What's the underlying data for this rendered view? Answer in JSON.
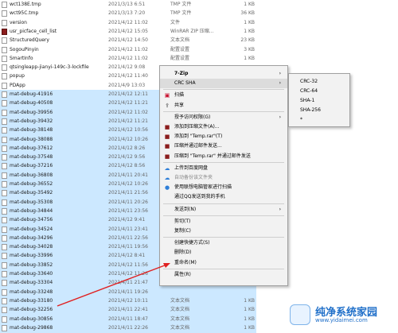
{
  "files": [
    {
      "name": "wct138E.tmp",
      "date": "2021/3/13 6:51",
      "type": "TMP 文件",
      "size": "1 KB",
      "icon": "file",
      "selected": false
    },
    {
      "name": "wct95C.tmp",
      "date": "2021/3/13 7:20",
      "type": "TMP 文件",
      "size": "36 KB",
      "icon": "file",
      "selected": false
    },
    {
      "name": "version",
      "date": "2021/4/12 11:02",
      "type": "文件",
      "size": "1 KB",
      "icon": "file",
      "selected": false
    },
    {
      "name": "usr_picface_cell_list",
      "date": "2021/4/12 15:05",
      "type": "WinRAR ZIP 压缩...",
      "size": "1 KB",
      "icon": "rar",
      "selected": false
    },
    {
      "name": "StructuredQuery",
      "date": "2021/4/12 14:50",
      "type": "文本文档",
      "size": "23 KB",
      "icon": "file",
      "selected": false
    },
    {
      "name": "SogouPinyin",
      "date": "2021/4/12 11:02",
      "type": "配置设置",
      "size": "3 KB",
      "icon": "file",
      "selected": false
    },
    {
      "name": "SmartInfo",
      "date": "2021/4/12 11:02",
      "type": "配置设置",
      "size": "1 KB",
      "icon": "file",
      "selected": false
    },
    {
      "name": "qtsingleapp-jianyi-149c-3-lockfile",
      "date": "2021/4/12 9:08",
      "type": "",
      "size": "",
      "icon": "file",
      "selected": false
    },
    {
      "name": "popup",
      "date": "2021/4/12 11:40",
      "type": "",
      "size": "",
      "icon": "file",
      "selected": false
    },
    {
      "name": "PDApp",
      "date": "2021/4/9 13:03",
      "type": "",
      "size": "",
      "icon": "file",
      "selected": false
    },
    {
      "name": "mat-debug-41916",
      "date": "2021/4/12 12:11",
      "type": "",
      "size": "",
      "icon": "file",
      "selected": true
    },
    {
      "name": "mat-debug-40508",
      "date": "2021/4/12 11:21",
      "type": "",
      "size": "",
      "icon": "file",
      "selected": true
    },
    {
      "name": "mat-debug-39956",
      "date": "2021/4/12 11:02",
      "type": "",
      "size": "",
      "icon": "file",
      "selected": true
    },
    {
      "name": "mat-debug-39432",
      "date": "2021/4/12 11:21",
      "type": "",
      "size": "",
      "icon": "file",
      "selected": true
    },
    {
      "name": "mat-debug-38148",
      "date": "2021/4/12 10:56",
      "type": "",
      "size": "",
      "icon": "file",
      "selected": true
    },
    {
      "name": "mat-debug-38088",
      "date": "2021/4/12 10:26",
      "type": "",
      "size": "",
      "icon": "file",
      "selected": true
    },
    {
      "name": "mat-debug-37612",
      "date": "2021/4/12 8:26",
      "type": "",
      "size": "",
      "icon": "file",
      "selected": true
    },
    {
      "name": "mat-debug-37548",
      "date": "2021/4/12 9:56",
      "type": "",
      "size": "",
      "icon": "file",
      "selected": true
    },
    {
      "name": "mat-debug-37216",
      "date": "2021/4/12 8:56",
      "type": "",
      "size": "",
      "icon": "file",
      "selected": true
    },
    {
      "name": "mat-debug-36808",
      "date": "2021/4/11 20:41",
      "type": "",
      "size": "",
      "icon": "file",
      "selected": true
    },
    {
      "name": "mat-debug-36552",
      "date": "2021/4/12 10:26",
      "type": "",
      "size": "",
      "icon": "file",
      "selected": true
    },
    {
      "name": "mat-debug-35492",
      "date": "2021/4/11 21:56",
      "type": "",
      "size": "",
      "icon": "file",
      "selected": true
    },
    {
      "name": "mat-debug-35308",
      "date": "2021/4/11 20:26",
      "type": "",
      "size": "",
      "icon": "file",
      "selected": true
    },
    {
      "name": "mat-debug-34844",
      "date": "2021/4/11 23:56",
      "type": "",
      "size": "",
      "icon": "file",
      "selected": true
    },
    {
      "name": "mat-debug-34756",
      "date": "2021/4/12 9:41",
      "type": "",
      "size": "",
      "icon": "file",
      "selected": true
    },
    {
      "name": "mat-debug-34524",
      "date": "2021/4/11 23:41",
      "type": "",
      "size": "",
      "icon": "file",
      "selected": true
    },
    {
      "name": "mat-debug-34296",
      "date": "2021/4/11 22:56",
      "type": "",
      "size": "",
      "icon": "file",
      "selected": true
    },
    {
      "name": "mat-debug-34028",
      "date": "2021/4/11 19:56",
      "type": "",
      "size": "",
      "icon": "file",
      "selected": true
    },
    {
      "name": "mat-debug-33996",
      "date": "2021/4/12 8:41",
      "type": "",
      "size": "",
      "icon": "file",
      "selected": true
    },
    {
      "name": "mat-debug-33852",
      "date": "2021/4/12 11:56",
      "type": "",
      "size": "",
      "icon": "file",
      "selected": true
    },
    {
      "name": "mat-debug-33640",
      "date": "2021/4/12 11:26",
      "type": "",
      "size": "",
      "icon": "file",
      "selected": true
    },
    {
      "name": "mat-debug-33304",
      "date": "2021/4/11 21:47",
      "type": "",
      "size": "",
      "icon": "file",
      "selected": true
    },
    {
      "name": "mat-debug-33248",
      "date": "2021/4/11 19:26",
      "type": "",
      "size": "",
      "icon": "file",
      "selected": true
    },
    {
      "name": "mat-debug-33180",
      "date": "2021/4/12 10:11",
      "type": "文本文档",
      "size": "1 KB",
      "icon": "file",
      "selected": true
    },
    {
      "name": "mat-debug-32256",
      "date": "2021/4/11 22:41",
      "type": "文本文档",
      "size": "1 KB",
      "icon": "file",
      "selected": true
    },
    {
      "name": "mat-debug-30856",
      "date": "2021/4/11 18:47",
      "type": "文本文档",
      "size": "1 KB",
      "icon": "file",
      "selected": true
    },
    {
      "name": "mat-debug-29868",
      "date": "2021/4/11 22:26",
      "type": "文本文档",
      "size": "1 KB",
      "icon": "file",
      "selected": true
    }
  ],
  "context_menu": {
    "items": [
      {
        "label": "7-Zip",
        "submenu": true,
        "icon": "",
        "bold": true
      },
      {
        "label": "CRC SHA",
        "submenu": true,
        "icon": "",
        "highlighted": true
      },
      {
        "label": "扫描",
        "icon": "mcafee-icon"
      },
      {
        "label": "共享",
        "icon": "share-icon"
      },
      {
        "label": "授予访问权限(G)",
        "submenu": true,
        "icon": ""
      },
      {
        "label": "添加到压缩文件(A)...",
        "icon": "rar-icon"
      },
      {
        "label": "添加到 \"Temp.rar\"(T)",
        "icon": "rar-icon"
      },
      {
        "label": "压缩并通过邮件发送...",
        "icon": "rar-icon"
      },
      {
        "label": "压缩到 \"Temp.rar\" 并通过邮件发送",
        "icon": "rar-icon"
      },
      {
        "label": "上传到百度网盘",
        "icon": "cloud-icon"
      },
      {
        "label": "自动备份该文件夹",
        "icon": "cloud-icon",
        "disabled": true
      },
      {
        "label": "使用联想电脑管家进行扫描",
        "icon": "lenovo-icon"
      },
      {
        "label": "通过QQ发送到我的手机",
        "icon": ""
      },
      {
        "label": "发送到(N)",
        "submenu": true,
        "icon": ""
      },
      {
        "label": "剪切(T)",
        "icon": ""
      },
      {
        "label": "复制(C)",
        "icon": ""
      },
      {
        "label": "创建快捷方式(S)",
        "icon": ""
      },
      {
        "label": "删除(D)",
        "icon": ""
      },
      {
        "label": "重命名(M)",
        "icon": ""
      },
      {
        "label": "属性(R)",
        "icon": ""
      }
    ]
  },
  "crc_submenu": {
    "items": [
      "CRC-32",
      "CRC-64",
      "SHA-1",
      "SHA-256",
      "*"
    ]
  },
  "watermark": {
    "title": "纯净系统家园",
    "url": "www.yidaimei.com"
  },
  "colors": {
    "selection": "#cce8ff",
    "menu_bg": "#f2f2f2",
    "annotation_arrow": "#e02020",
    "watermark": "#1f6fc9"
  }
}
